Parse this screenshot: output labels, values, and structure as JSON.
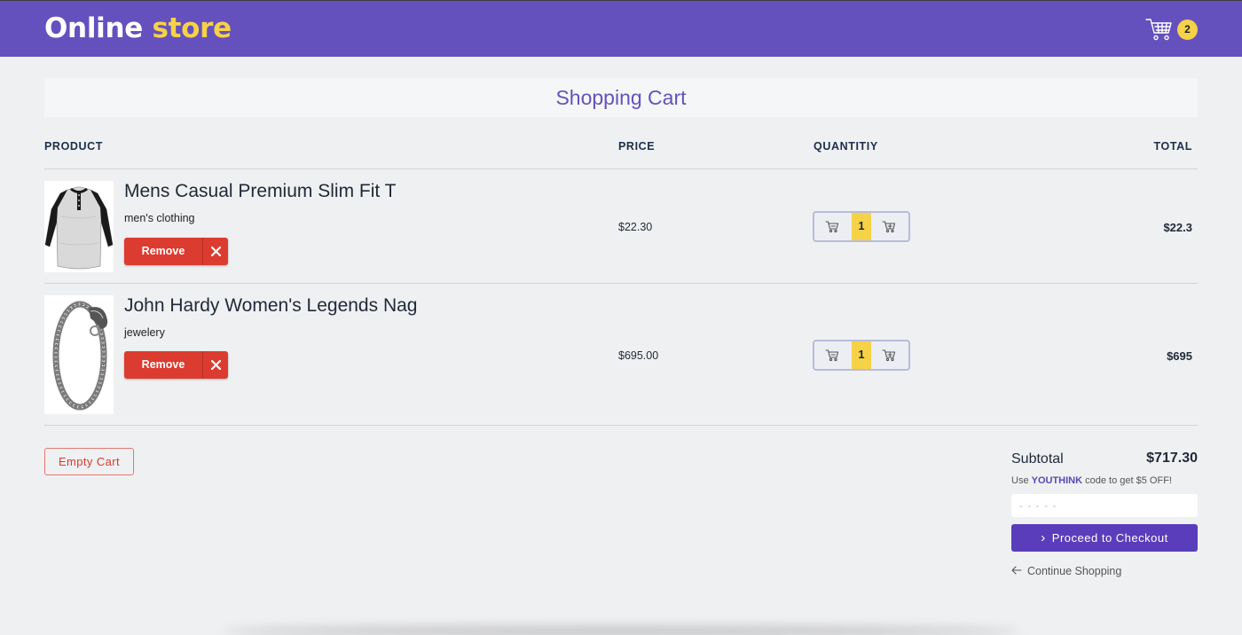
{
  "header": {
    "brand_part1": "Online",
    "brand_part2": "store",
    "cart_count": "2",
    "cart_icon": "shopping-cart-icon"
  },
  "page_title": "Shopping Cart",
  "columns": {
    "product": "PRODUCT",
    "price": "PRICE",
    "quantity": "QUANTITIY",
    "total": "TOTAL"
  },
  "items": [
    {
      "name": "Mens Casual Premium Slim Fit T",
      "category": "men's clothing",
      "remove_label": "Remove",
      "price": "$22.30",
      "quantity": "1",
      "total": "$22.3",
      "image_icon": "henley-shirt-image"
    },
    {
      "name": "John Hardy Women's Legends Nag",
      "category": "jewelery",
      "remove_label": "Remove",
      "price": "$695.00",
      "quantity": "1",
      "total": "$695",
      "image_icon": "dragon-bracelet-image"
    }
  ],
  "empty_cart_label": "Empty Cart",
  "summary": {
    "subtotal_label": "Subtotal",
    "subtotal_value": "$717.30",
    "promo_prefix": "Use",
    "promo_code": "YOUTHINK",
    "promo_suffix": "code to get $5 OFF!",
    "coupon_placeholder": "- - - - -",
    "checkout_label": "Proceed to Checkout",
    "continue_label": "Continue Shopping"
  },
  "colors": {
    "header_bg": "#6551bd",
    "brand_accent": "#f5d247",
    "remove_red": "#dc3b2f",
    "checkout_purple": "#5a3dba",
    "qty_highlight": "#f5d247"
  }
}
